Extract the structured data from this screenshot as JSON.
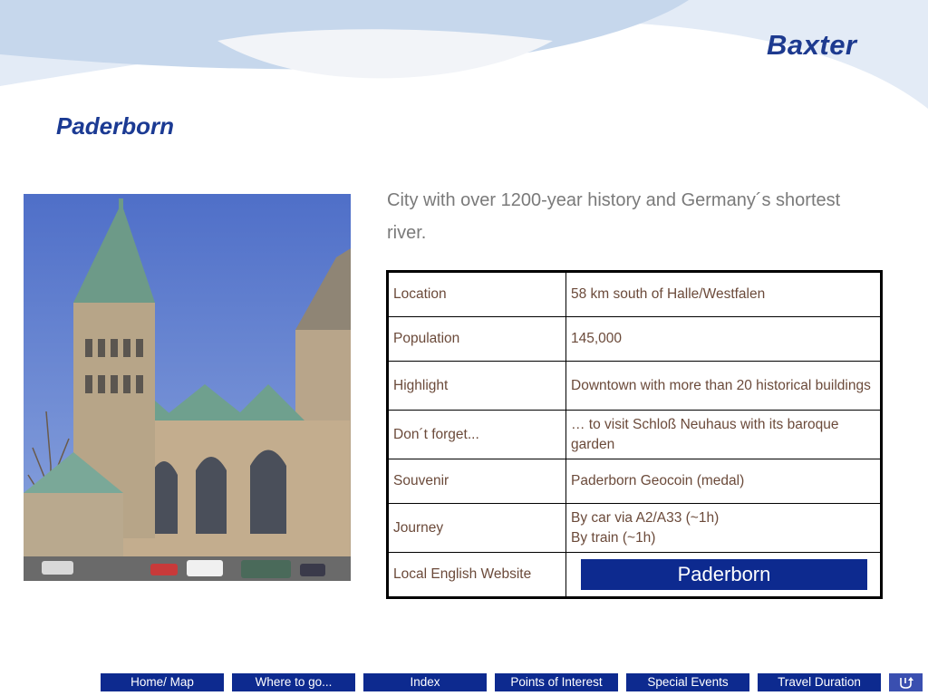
{
  "slide": {
    "logo_text": "Baxter",
    "title": "Paderborn",
    "intro": "City with over 1200-year history and Germany´s shortest river."
  },
  "facts_table": {
    "rows": [
      {
        "label": "Location",
        "value_lines": [
          "58 km south of Halle/Westfalen"
        ]
      },
      {
        "label": "Population",
        "value_lines": [
          "145,000"
        ]
      },
      {
        "label": "Highlight",
        "value_lines": [
          "Downtown with more than 20 historical buildings"
        ]
      },
      {
        "label": "Don´t forget...",
        "value_lines": [
          "… to visit Schloß Neuhaus with its baroque garden"
        ]
      },
      {
        "label": "Souvenir",
        "value_lines": [
          "Paderborn Geocoin (medal)"
        ]
      },
      {
        "label": "Journey",
        "value_lines": [
          "By car via A2/A33 (~1h)",
          "By train (~1h)"
        ]
      },
      {
        "label": "Local English Website",
        "button_label": "Paderborn"
      }
    ]
  },
  "nav": {
    "items": [
      "Home/ Map",
      "Where to go...",
      "Index",
      "Points of Interest",
      "Special Events",
      "Travel Duration"
    ],
    "back_icon": "return-arrow-icon"
  },
  "colors": {
    "brand_blue": "#0d2a8f",
    "title_blue": "#1b3a93",
    "header_light_blue": "#c9d9ee",
    "table_text": "#6b4a3a",
    "intro_gray": "#7a7a7a"
  }
}
